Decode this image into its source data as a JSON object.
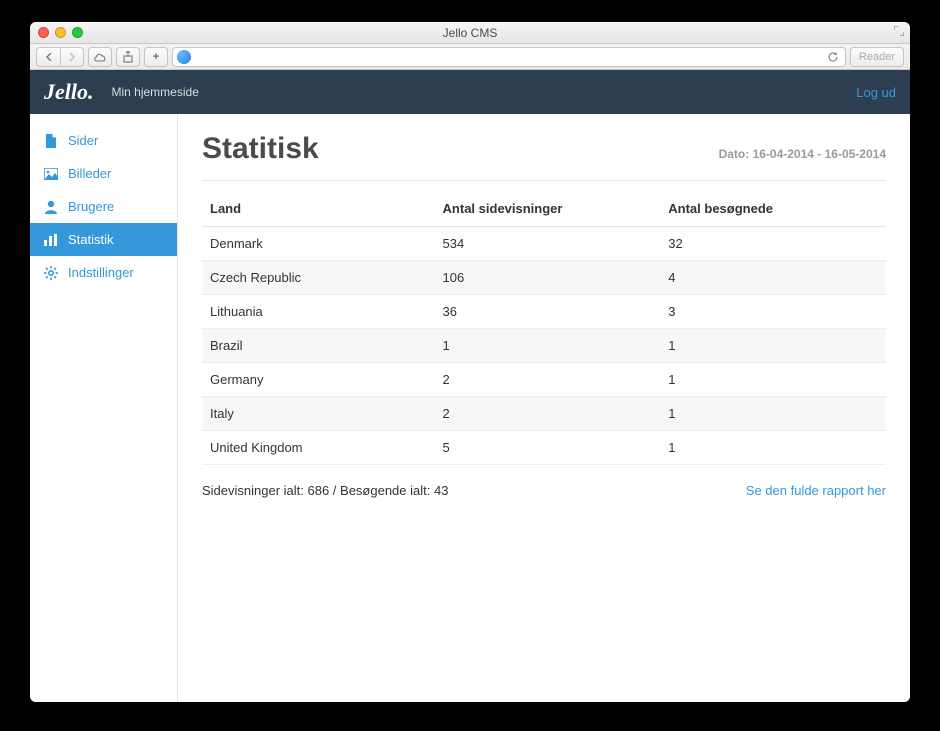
{
  "browser": {
    "title": "Jello CMS",
    "reader_label": "Reader"
  },
  "header": {
    "logo_text": "Jello.",
    "site_name": "Min hjemmeside",
    "logout_label": "Log ud"
  },
  "sidebar": {
    "items": [
      {
        "icon": "page-icon",
        "label": "Sider",
        "active": false
      },
      {
        "icon": "image-icon",
        "label": "Billeder",
        "active": false
      },
      {
        "icon": "user-icon",
        "label": "Brugere",
        "active": false
      },
      {
        "icon": "bars-icon",
        "label": "Statistik",
        "active": true
      },
      {
        "icon": "gear-icon",
        "label": "Indstillinger",
        "active": false
      }
    ]
  },
  "main": {
    "title": "Statitisk",
    "date_prefix": "Dato: ",
    "date_range": "16-04-2014 - 16-05-2014",
    "columns": {
      "country": "Land",
      "page_views": "Antal sidevisninger",
      "visitors": "Antal besøgnede"
    },
    "rows": [
      {
        "country": "Denmark",
        "page_views": "534",
        "visitors": "32"
      },
      {
        "country": "Czech Republic",
        "page_views": "106",
        "visitors": "4"
      },
      {
        "country": "Lithuania",
        "page_views": "36",
        "visitors": "3"
      },
      {
        "country": "Brazil",
        "page_views": "1",
        "visitors": "1"
      },
      {
        "country": "Germany",
        "page_views": "2",
        "visitors": "1"
      },
      {
        "country": "Italy",
        "page_views": "2",
        "visitors": "1"
      },
      {
        "country": "United Kingdom",
        "page_views": "5",
        "visitors": "1"
      }
    ],
    "totals_text": "Sidevisninger ialt: 686 / Besøgende ialt: 43",
    "full_report_label": "Se den fulde rapport her"
  }
}
